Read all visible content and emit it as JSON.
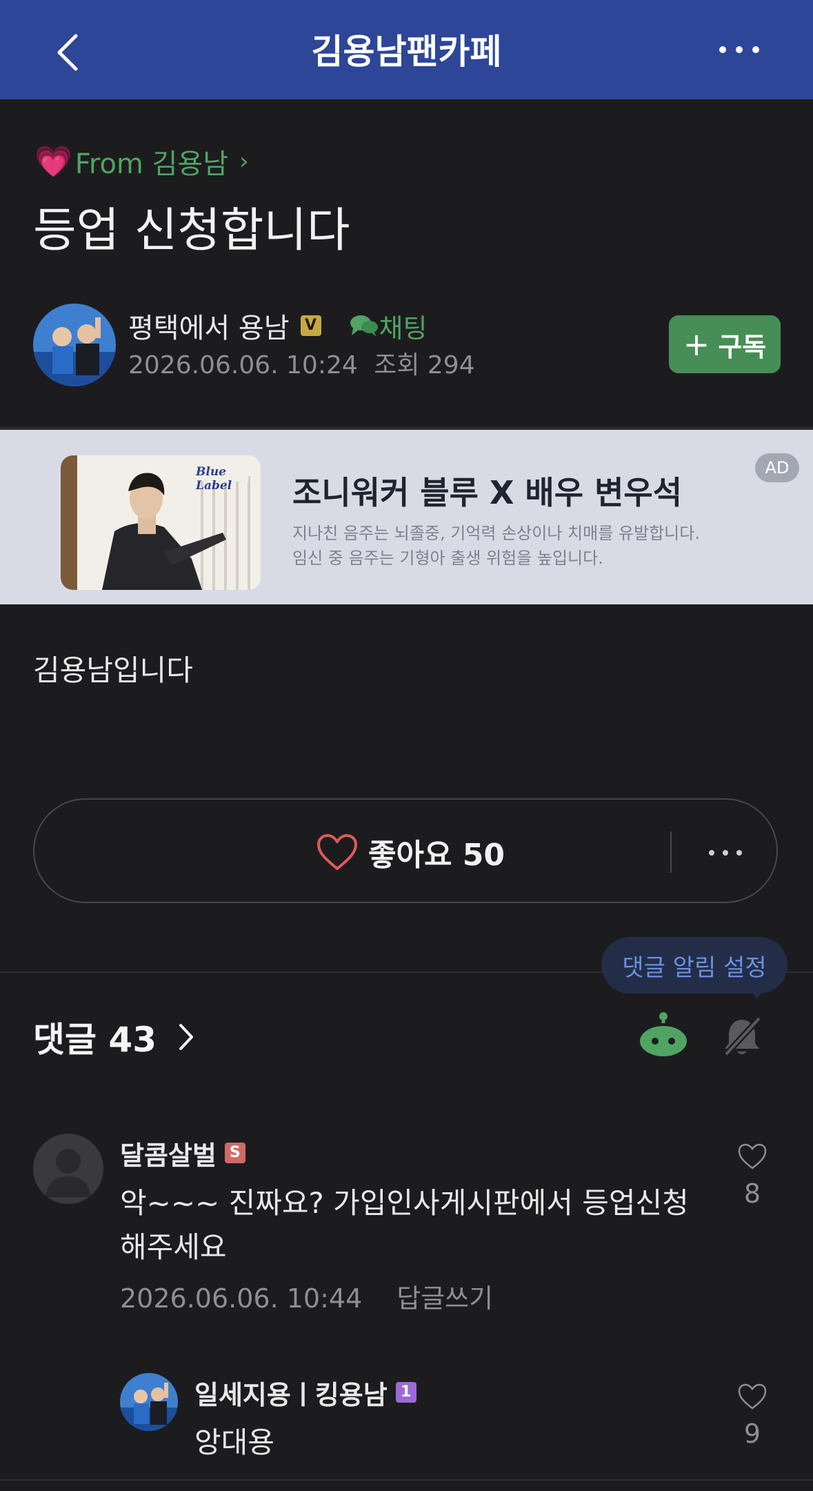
{
  "header": {
    "title": "김용남팬카페",
    "back_icon": "chevron-left-icon",
    "more_icon": "ellipsis-icon",
    "background": "#2d4698"
  },
  "post": {
    "board_prefix_icon": "pink-heart-emoji",
    "board_name": "From 김용남",
    "title": "등업 신청합니다",
    "author": "평택에서 용남",
    "author_badge": "V",
    "chat_label": "채팅",
    "date": "2026.06.06. 10:24",
    "views": "조회 294",
    "subscribe_label": "구독",
    "body": "김용남입니다"
  },
  "ad": {
    "headline": "조니워커 블루 X 배우 변우석",
    "warning_line1": "지나친 음주는 뇌졸중, 기억력 손상이나 치매를 유발합니다.",
    "warning_line2": "임신 중 음주는 기형아 출생 위험을 높입니다.",
    "badge": "AD",
    "logo_text": "Blue Label"
  },
  "like": {
    "label": "좋아요 50"
  },
  "comments": {
    "header": "댓글 43",
    "tooltip": "댓글 알림 설정",
    "items": [
      {
        "author": "달콤살벌",
        "badge": "S",
        "text": "악~~~ 진짜요? 가입인사게시판에서 등업신청 해주세요",
        "date": "2026.06.06. 10:44",
        "reply_label": "답글쓰기",
        "likes": "8"
      },
      {
        "author": "일세지용ㅣ킹용남",
        "badge": "1",
        "text": "앙대용",
        "likes": "9"
      }
    ]
  },
  "colors": {
    "background": "#1c1c1e",
    "accent_green": "#4fa463",
    "subscribe_green": "#468e56",
    "tooltip_text": "#6b8fe0"
  }
}
